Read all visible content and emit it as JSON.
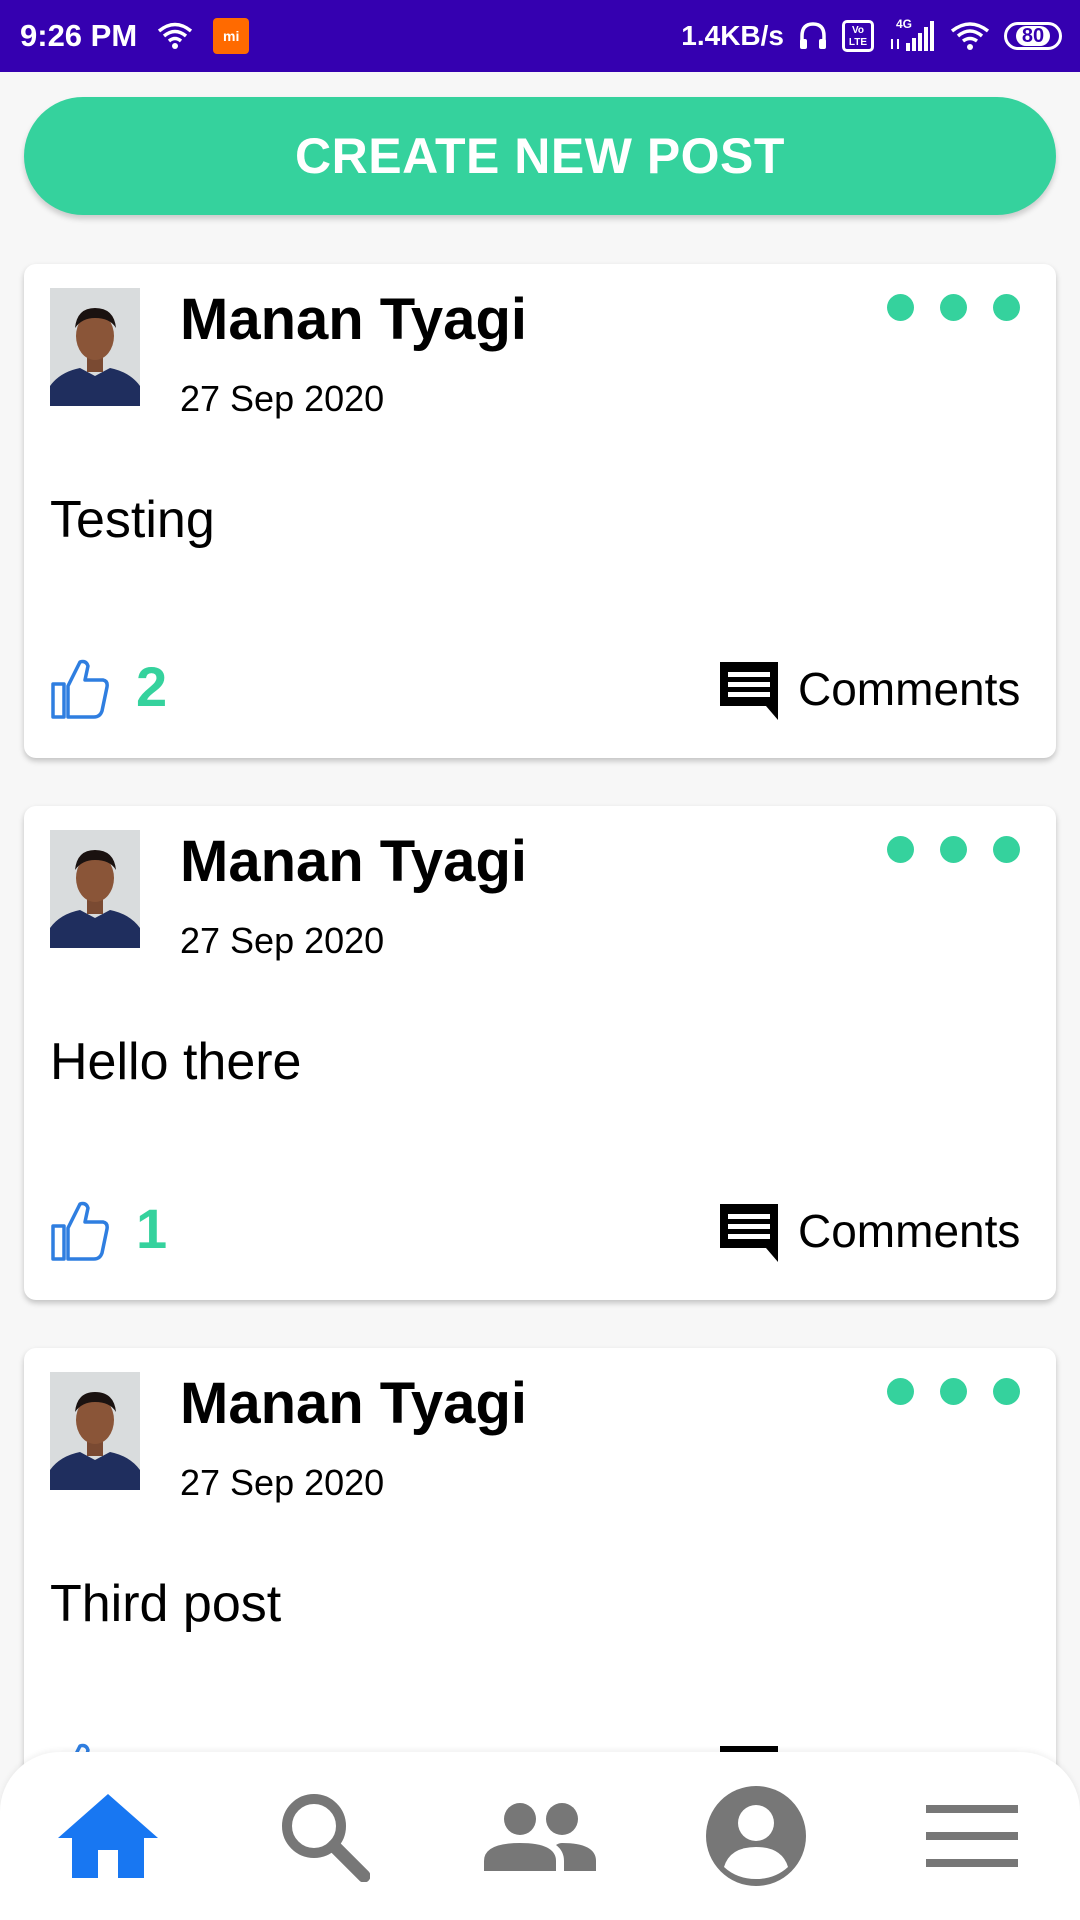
{
  "status_bar": {
    "time": "9:26 PM",
    "mi_label": "mi",
    "net_speed": "1.4KB/s",
    "volte": "Vo LTE",
    "network": "4G",
    "battery": "80"
  },
  "create_post_label": "CREATE NEW POST",
  "posts": [
    {
      "author": "Manan Tyagi",
      "date": "27 Sep 2020",
      "text": "Testing",
      "likes": "2",
      "comments_label": "Comments"
    },
    {
      "author": "Manan Tyagi",
      "date": "27 Sep 2020",
      "text": "Hello there",
      "likes": "1",
      "comments_label": "Comments"
    },
    {
      "author": "Manan Tyagi",
      "date": "27 Sep 2020",
      "text": "Third post",
      "likes": "",
      "comments_label": ""
    }
  ],
  "bottom_nav": [
    {
      "icon": "home-icon",
      "active": true
    },
    {
      "icon": "search-icon",
      "active": false
    },
    {
      "icon": "friends-icon",
      "active": false
    },
    {
      "icon": "profile-icon",
      "active": false
    },
    {
      "icon": "menu-icon",
      "active": false
    }
  ],
  "colors": {
    "status_bar": "#3500b0",
    "accent": "#35d29d",
    "like_icon": "#2f7ee0",
    "nav_active": "#1877f2",
    "nav_inactive": "#777777"
  }
}
